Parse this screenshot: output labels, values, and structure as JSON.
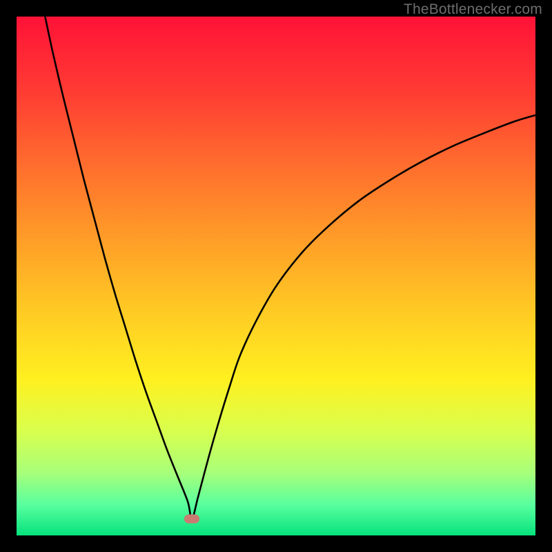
{
  "attribution": "TheBottlenecker.com",
  "colors": {
    "frame": "#000000",
    "marker": "#c97b72",
    "curve": "#000000"
  },
  "chart_data": {
    "type": "line",
    "title": "",
    "xlabel": "",
    "ylabel": "",
    "xlim": [
      0,
      100
    ],
    "ylim": [
      0,
      100
    ],
    "grid": false,
    "legend": false,
    "series": [
      {
        "name": "left-branch",
        "x": [
          5.5,
          7,
          9,
          11,
          13,
          15,
          17,
          19,
          21,
          23,
          25,
          27,
          29,
          31,
          33,
          33.8
        ],
        "values": [
          100,
          93,
          84.5,
          76.5,
          68.5,
          61,
          53.5,
          46.5,
          40,
          33.5,
          27.5,
          22,
          16.5,
          11.5,
          6.5,
          3.2
        ]
      },
      {
        "name": "right-branch",
        "x": [
          33.8,
          35,
          37,
          39,
          41,
          43,
          46,
          50,
          55,
          60,
          66,
          72,
          78,
          84,
          90,
          96,
          100
        ],
        "values": [
          3.2,
          7.5,
          15,
          22,
          28.5,
          34.5,
          41,
          48,
          54.5,
          59.5,
          64.5,
          68.5,
          72,
          75,
          77.5,
          79.8,
          81
        ]
      }
    ],
    "annotations": [
      {
        "name": "min-marker",
        "x": 33.8,
        "y": 3.2
      }
    ]
  }
}
